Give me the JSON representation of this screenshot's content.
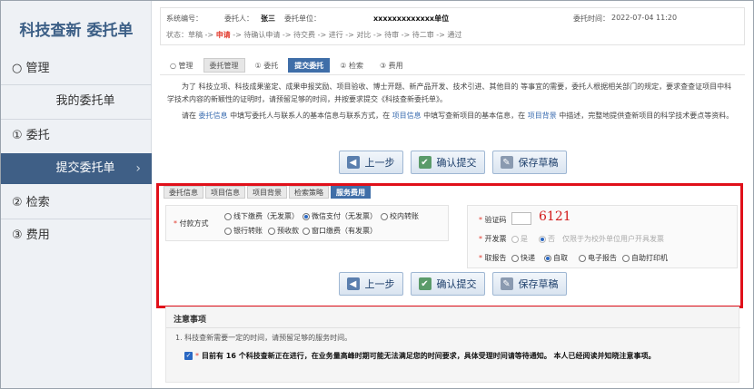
{
  "sidebar": {
    "title": "科技查新 委托单",
    "items": [
      {
        "label": "○ 管理"
      },
      {
        "label": "我的委托单"
      },
      {
        "label": "① 委托"
      },
      {
        "label": "提交委托单"
      },
      {
        "label": "② 检索"
      },
      {
        "label": "③ 费用"
      }
    ]
  },
  "info": {
    "system_no_label": "系统编号：",
    "client_label": "委托人：",
    "client_value": "张三",
    "unit_label": "委托单位：",
    "unit_value": "xxxxxxxxxxxxx单位",
    "time_label": "委托时间：",
    "time_value": "2022-07-04 11:20",
    "status_prefix": "状态：草稿 -> ",
    "status_current": "申请",
    "status_suffix": " -> 待确认申请 -> 待交费 -> 进行 -> 对比 -> 待审 -> 待二审 -> 通过"
  },
  "top_tabs": [
    "○ 管理",
    "委托管理",
    "① 委托",
    "提交委托",
    "② 检索",
    "③ 费用"
  ],
  "description": {
    "p1": "为了 科技立项、科技成果鉴定、成果申报奖励、项目验收、博士开题、新产品开发、技术引进、其他目的 等事宜的需要，委托人根据相关部门的规定，要求查查证项目中科学技术内容的新颖性的证明时，请预留足够的时间，并按要求提交《科技查新委托单》。",
    "p2_a": "请在 ",
    "p2_b": "委托信息",
    "p2_c": " 中填写委托人与联系人的基本信息与联系方式，在 ",
    "p2_d": "项目信息",
    "p2_e": " 中填写查新项目的基本信息，在 ",
    "p2_f": "项目背景",
    "p2_g": " 中描述，完整地提供查新项目的科学技术要点等资料。"
  },
  "buttons": {
    "prev": "上一步",
    "confirm": "确认提交",
    "save": "保存草稿"
  },
  "sub_tabs": [
    "委托信息",
    "项目信息",
    "项目背景",
    "检索策略",
    "服务费用"
  ],
  "payment": {
    "label": "付款方式",
    "options": [
      "线下缴费（无发票）",
      "微信支付（无发票）",
      "校内转账",
      "银行转账",
      "预收款",
      "窗口缴费（有发票）"
    ]
  },
  "captcha": {
    "label": "验证码",
    "image_text": "6121"
  },
  "invoice": {
    "label": "开发票",
    "options": [
      "是",
      "否"
    ],
    "note": "仅限于为校外单位用户开具发票"
  },
  "report": {
    "label": "取报告",
    "options": [
      "快递",
      "自取",
      "电子报告",
      "自助打印机"
    ]
  },
  "notes": {
    "title": "注意事项",
    "item1": "1. 科技查新需要一定的时间，请预留足够的服务时间。",
    "item2": "目前有 16 个科技查新正在进行，在业务量高峰时期可能无法满足您的时间要求，具体受理时间请等待通知。 本人已经阅读并知晓注意事项。"
  }
}
